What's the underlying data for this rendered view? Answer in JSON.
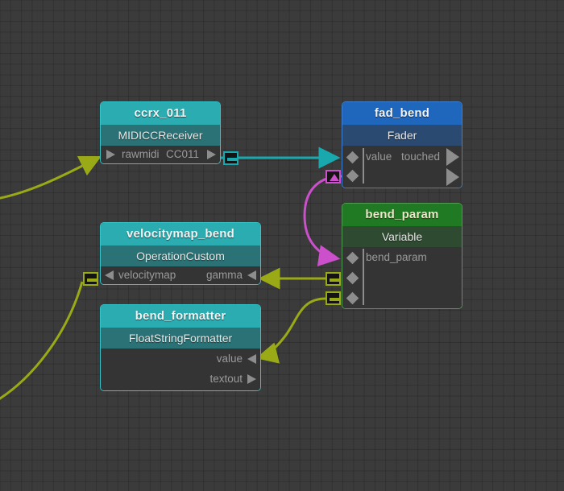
{
  "app": {
    "view": "node-graph-editor",
    "background_color": "#3b3b3b",
    "grid_color": "#303030"
  },
  "colors": {
    "teal": "#2aacb1",
    "teal_border": "#35c4c9",
    "teal_sub": "#2a7275",
    "blue": "#1f66bd",
    "blue_border": "#3d7fd0",
    "blue_sub": "#2b4a71",
    "green": "#1f7a23",
    "green_border": "#4f9b52",
    "green_sub": "#2e4a30",
    "node_body": "#343434",
    "wire_teal": "#19a8ad",
    "wire_magenta": "#cc4fcc",
    "wire_olive": "#9aaa17",
    "port_glyph": "#8d8d8d",
    "port_text": "#9a9a9a"
  },
  "nodes": [
    {
      "id": "ccrx_011",
      "title": "ccrx_011",
      "type_label": "MIDICCReceiver",
      "theme": "teal",
      "inputs": [
        {
          "label": "rawmidi",
          "glyph": "triangle-right"
        }
      ],
      "outputs": [
        {
          "label": "CC011",
          "glyph": "triangle-right"
        }
      ]
    },
    {
      "id": "fad_bend",
      "title": "fad_bend",
      "type_label": "Fader",
      "theme": "blue",
      "inputs": [
        {
          "label": "value",
          "glyph": "diamond"
        },
        {
          "label": "",
          "glyph": "diamond"
        }
      ],
      "outputs": [
        {
          "label": "touched",
          "glyph": "triangle-right"
        },
        {
          "label": "",
          "glyph": "triangle-right"
        }
      ]
    },
    {
      "id": "bend_param",
      "title": "bend_param",
      "type_label": "Variable",
      "theme": "green",
      "inputs": [
        {
          "label": "bend_param",
          "glyph": "diamond"
        },
        {
          "label": "",
          "glyph": "diamond"
        },
        {
          "label": "",
          "glyph": "diamond"
        }
      ],
      "outputs": []
    },
    {
      "id": "velocitymap_bend",
      "title": "velocitymap_bend",
      "type_label": "OperationCustom",
      "theme": "teal",
      "inputs": [
        {
          "label": "velocitymap",
          "glyph": "triangle-left"
        }
      ],
      "outputs": [
        {
          "label": "gamma",
          "glyph": "triangle-left"
        }
      ]
    },
    {
      "id": "bend_formatter",
      "title": "bend_formatter",
      "type_label": "FloatStringFormatter",
      "theme": "teal",
      "inputs": [
        {
          "label": "value",
          "glyph": "triangle-left"
        }
      ],
      "outputs": [
        {
          "label": "textout",
          "glyph": "triangle-right"
        }
      ]
    }
  ],
  "markers": [
    {
      "id": "marker-ccrx-to-fad",
      "icon": "minus",
      "color": "#19a8ad"
    },
    {
      "id": "marker-fad-to-bendparam",
      "icon": "triangle-up",
      "color": "#cc4fcc"
    },
    {
      "id": "marker-velocitymap-in",
      "icon": "minus",
      "color": "#9aaa17"
    },
    {
      "id": "marker-bendparam-out-gamma",
      "icon": "minus",
      "color": "#9aaa17"
    },
    {
      "id": "marker-bendparam-out-value",
      "icon": "minus",
      "color": "#9aaa17"
    }
  ],
  "wires": [
    {
      "id": "wire-ccrx-cc011-to-fad-value",
      "color": "#19a8ad",
      "from": "ccrx_011.CC011",
      "to": "fad_bend.value"
    },
    {
      "id": "wire-fad-to-bend-param",
      "color": "#cc4fcc",
      "from": "fad_bend.out",
      "to": "bend_param.bend_param"
    },
    {
      "id": "wire-bendparam-to-gamma",
      "color": "#9aaa17",
      "from": "bend_param",
      "to": "velocitymap_bend.gamma"
    },
    {
      "id": "wire-bendparam-to-formatter-value",
      "color": "#9aaa17",
      "from": "bend_param",
      "to": "bend_formatter.value"
    },
    {
      "id": "wire-offscreen-to-rawmidi",
      "color": "#9aaa17",
      "from": "offscreen-left",
      "to": "ccrx_011.rawmidi"
    },
    {
      "id": "wire-offscreen-to-velocitymap",
      "color": "#9aaa17",
      "from": "offscreen-bottom-left",
      "to": "velocitymap_bend.velocitymap"
    }
  ]
}
